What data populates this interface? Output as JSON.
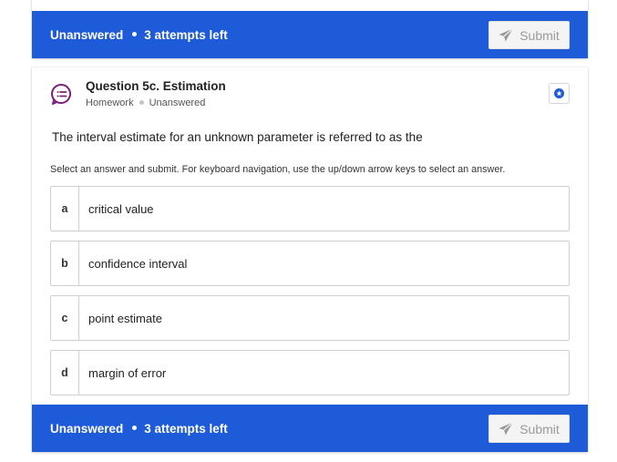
{
  "previous_question": {
    "footer": {
      "status": "Unanswered",
      "attempts": "3 attempts left",
      "submit_label": "Submit"
    }
  },
  "question": {
    "title": "Question 5c. Estimation",
    "category": "Homework",
    "state": "Unanswered",
    "icon": "question-list-icon",
    "prompt": "The interval estimate for an unknown parameter is referred to as the",
    "instructions": "Select an answer and submit. For keyboard navigation, use the up/down arrow keys to select an answer.",
    "options": [
      {
        "letter": "a",
        "text": "critical value"
      },
      {
        "letter": "b",
        "text": "confidence interval"
      },
      {
        "letter": "c",
        "text": "point estimate"
      },
      {
        "letter": "d",
        "text": "margin of error"
      }
    ],
    "footer": {
      "status": "Unanswered",
      "attempts": "3 attempts left",
      "submit_label": "Submit"
    }
  },
  "colors": {
    "footer_bg": "#1e5bd8",
    "icon_purple": "#7b1f7a",
    "bookmark_blue": "#1e5bd8"
  }
}
